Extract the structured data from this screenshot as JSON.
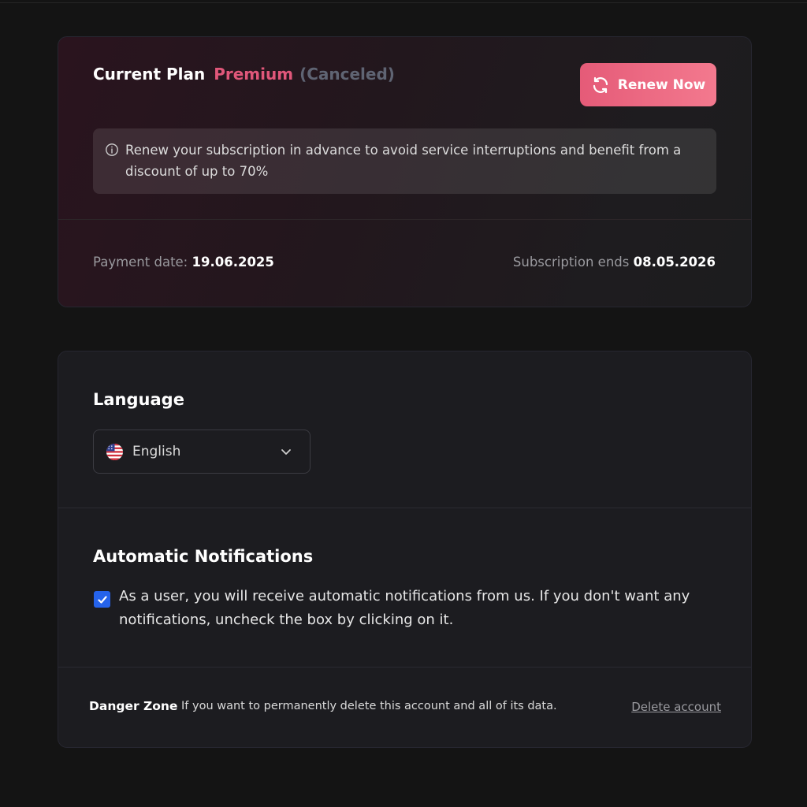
{
  "plan": {
    "label": "Current Plan",
    "tier": "Premium",
    "status": "(Canceled)",
    "renew_button": "Renew Now",
    "info_text": "Renew your subscription in advance to avoid service interruptions and benefit from a discount of up to 70%",
    "payment_label": "Payment date:",
    "payment_date": "19.06.2025",
    "ends_label": "Subscription ends",
    "ends_date": "08.05.2026",
    "icons": {
      "renew": "refresh-icon",
      "info": "info-icon"
    }
  },
  "language": {
    "heading": "Language",
    "selected": "English",
    "icons": {
      "flag": "us-flag-icon",
      "chevron": "chevron-down-icon"
    }
  },
  "notifications": {
    "heading": "Automatic Notifications",
    "checked": true,
    "text": "As a user, you will receive automatic notifications from us. If you don't want any notifications, uncheck the box by clicking on it."
  },
  "danger_zone": {
    "title": "Danger Zone",
    "text": "If you want to permanently delete this account and all of its data.",
    "delete_link": "Delete account"
  },
  "colors": {
    "background": "#141414",
    "accent": "#e55b78",
    "premium": "#e0577a",
    "checkbox": "#2563eb"
  }
}
